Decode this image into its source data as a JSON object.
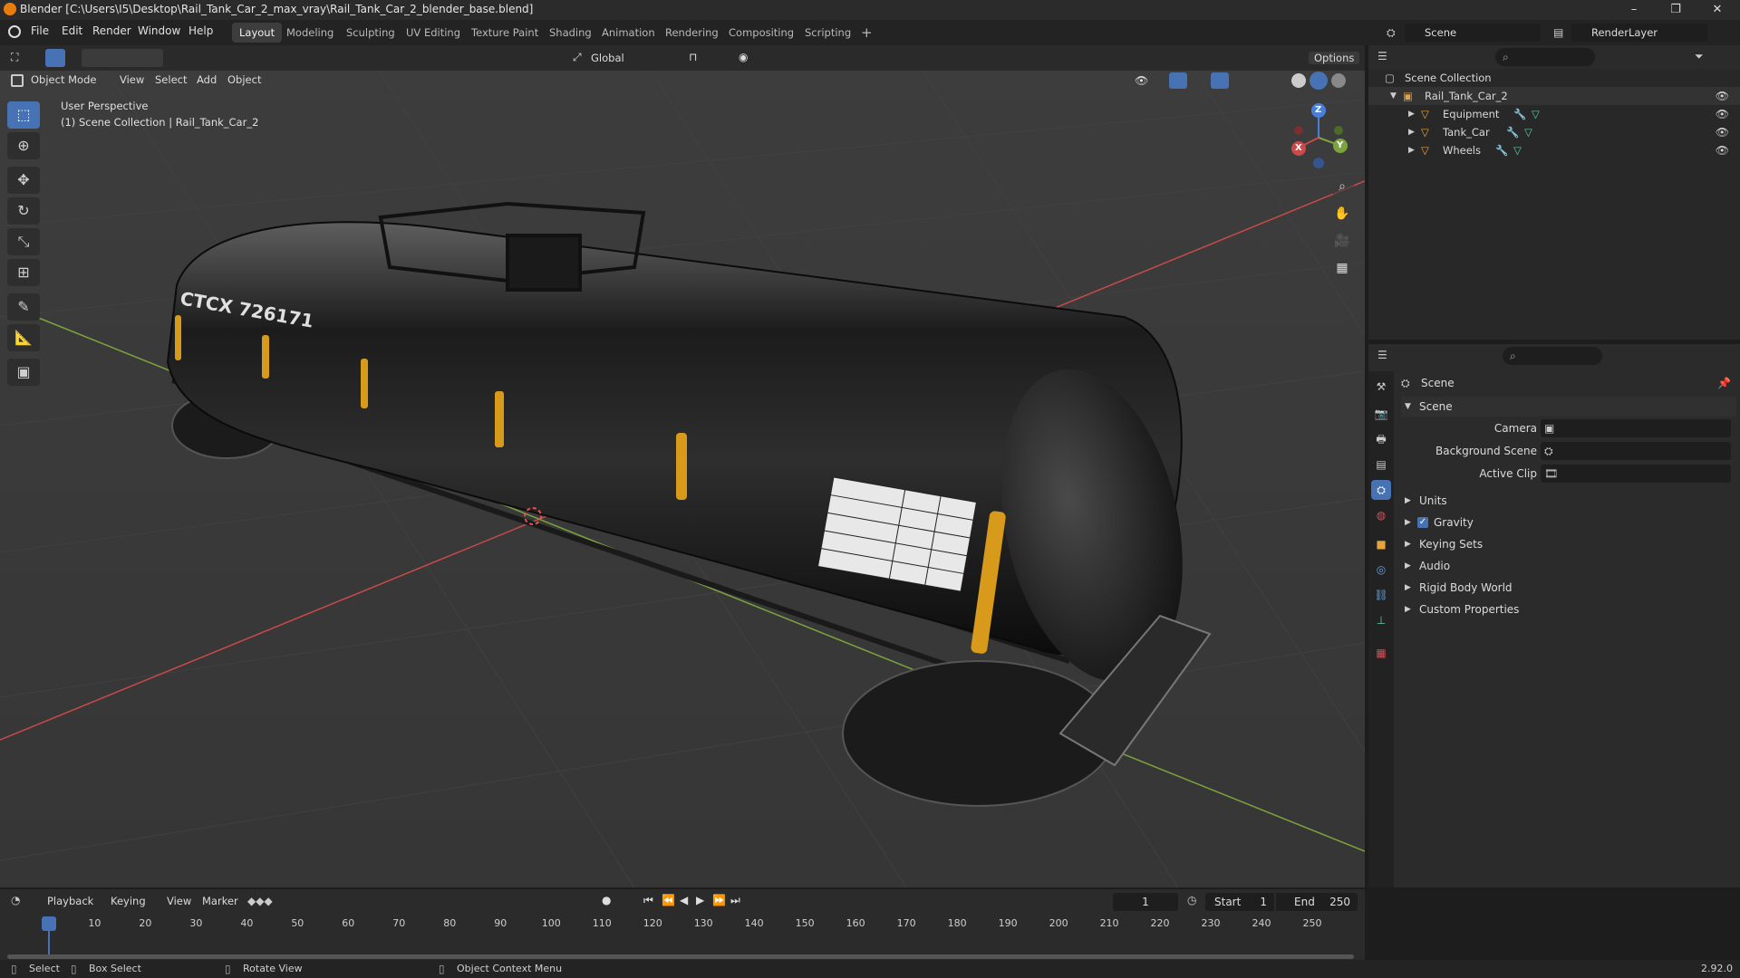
{
  "window": {
    "title": "Blender [C:\\Users\\I5\\Desktop\\Rail_Tank_Car_2_max_vray\\Rail_Tank_Car_2_blender_base.blend]",
    "controls": [
      "–",
      "❐",
      "✕"
    ]
  },
  "menu": [
    "File",
    "Edit",
    "Render",
    "Window",
    "Help"
  ],
  "workspaces": {
    "tabs": [
      "Layout",
      "Modeling",
      "Sculpting",
      "UV Editing",
      "Texture Paint",
      "Shading",
      "Animation",
      "Rendering",
      "Compositing",
      "Scripting"
    ],
    "active": "Layout",
    "add": "+"
  },
  "scene_selector": {
    "scene": "Scene",
    "render_layer": "RenderLayer"
  },
  "viewport_header": {
    "mode": "Object Mode",
    "menus": [
      "View",
      "Select",
      "Add",
      "Object"
    ],
    "orientation": "Global",
    "options": "Options"
  },
  "viewport": {
    "perspective": "User Perspective",
    "collection_info": "(1) Scene Collection | Rail_Tank_Car_2",
    "gizmo_axes": {
      "x": "X",
      "y": "Y",
      "z": "Z"
    },
    "model_text": {
      "reporting_mark": "CTCX 726171"
    },
    "colors": {
      "background": "#3a3a3a",
      "x_axis": "#c84a4a",
      "y_axis": "#7ca33d",
      "accent": "#4772b3",
      "tank": "#151515",
      "stripe": "#d79a1a"
    }
  },
  "toolbar_icons": [
    "select-box-icon",
    "cursor-icon",
    "move-icon",
    "rotate-icon",
    "scale-icon",
    "transform-icon",
    "annotate-icon",
    "measure-icon",
    "add-cube-icon"
  ],
  "outliner": {
    "root": "Scene Collection",
    "collection": "Rail_Tank_Car_2",
    "objects": [
      "Equipment",
      "Tank_Car",
      "Wheels"
    ]
  },
  "properties": {
    "header": "Scene",
    "panel": "Scene",
    "fields": [
      {
        "label": "Camera",
        "value": ""
      },
      {
        "label": "Background Scene",
        "value": ""
      },
      {
        "label": "Active Clip",
        "value": ""
      }
    ],
    "sections": [
      "Units",
      "Gravity",
      "Keying Sets",
      "Audio",
      "Rigid Body World",
      "Custom Properties"
    ],
    "gravity_checked": true
  },
  "timeline": {
    "menus": [
      "Playback",
      "Keying",
      "View",
      "Marker"
    ],
    "current_frame": "1",
    "start_label": "Start",
    "start": "1",
    "end_label": "End",
    "end": "250",
    "ticks": [
      "1",
      "10",
      "20",
      "30",
      "40",
      "50",
      "60",
      "70",
      "80",
      "90",
      "100",
      "110",
      "120",
      "130",
      "140",
      "150",
      "160",
      "170",
      "180",
      "190",
      "200",
      "210",
      "220",
      "230",
      "240",
      "250"
    ]
  },
  "statusbar": {
    "items": [
      "Select",
      "Box Select",
      "Rotate View",
      "Object Context Menu"
    ],
    "version": "2.92.0"
  }
}
